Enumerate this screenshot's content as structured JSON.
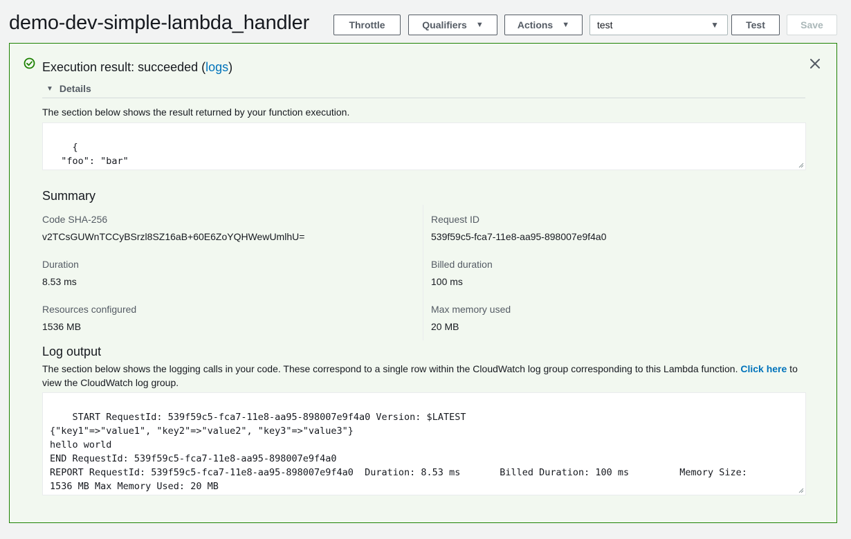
{
  "header": {
    "function_name": "demo-dev-simple-lambda_handler",
    "throttle_label": "Throttle",
    "qualifiers_label": "Qualifiers",
    "actions_label": "Actions",
    "test_event_selected": "test",
    "test_label": "Test",
    "save_label": "Save"
  },
  "result": {
    "title_prefix": "Execution result: succeeded (",
    "logs_link": "logs",
    "title_suffix": ")",
    "details_label": "Details",
    "description": "The section below shows the result returned by your function execution.",
    "output": "{\n  \"foo\": \"bar\"\n}"
  },
  "summary": {
    "title": "Summary",
    "code_sha_label": "Code SHA-256",
    "code_sha_value": "v2TCsGUWnTCCyBSrzl8SZ16aB+60E6ZoYQHWewUmlhU=",
    "request_id_label": "Request ID",
    "request_id_value": "539f59c5-fca7-11e8-aa95-898007e9f4a0",
    "duration_label": "Duration",
    "duration_value": "8.53 ms",
    "billed_duration_label": "Billed duration",
    "billed_duration_value": "100 ms",
    "resources_label": "Resources configured",
    "resources_value": "1536 MB",
    "max_memory_label": "Max memory used",
    "max_memory_value": "20 MB"
  },
  "log": {
    "title": "Log output",
    "description": "The section below shows the logging calls in your code. These correspond to a single row within the CloudWatch log group corresponding to this Lambda function. ",
    "click_here": "Click here",
    "description_suffix": " to view the CloudWatch log group.",
    "output": "START RequestId: 539f59c5-fca7-11e8-aa95-898007e9f4a0 Version: $LATEST\n{\"key1\"=>\"value1\", \"key2\"=>\"value2\", \"key3\"=>\"value3\"}\nhello world\nEND RequestId: 539f59c5-fca7-11e8-aa95-898007e9f4a0\nREPORT RequestId: 539f59c5-fca7-11e8-aa95-898007e9f4a0  Duration: 8.53 ms       Billed Duration: 100 ms         Memory Size:\n1536 MB Max Memory Used: 20 MB"
  },
  "colors": {
    "success": "#1d8102",
    "link": "#0073bb",
    "panel_bg": "#f2f8f0"
  },
  "icons": [
    "check-circle-icon",
    "close-icon",
    "caret-down-icon",
    "triangle-down-icon",
    "resize-grip-icon"
  ]
}
